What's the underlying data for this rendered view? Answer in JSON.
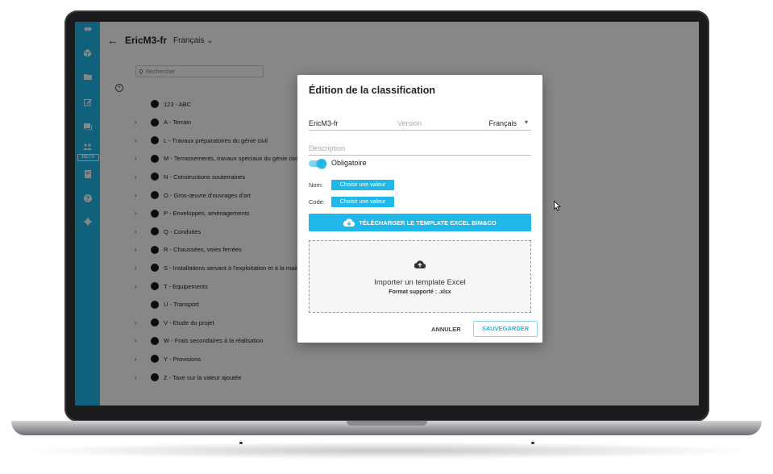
{
  "header": {
    "back_label": "←",
    "project_name": "EricM3-fr",
    "language": "Français",
    "language_chevron": "⌄"
  },
  "search": {
    "placeholder": "Rechercher"
  },
  "sidebar": {
    "icons": [
      "handshake-icon",
      "cube-icon",
      "folder-icon",
      "edit-icon",
      "chat-icon",
      "users-icon",
      "document-icon",
      "help-icon",
      "settings-icon"
    ],
    "beta_label": "BETA"
  },
  "tree": {
    "add_label": "+",
    "items": [
      {
        "label": "123 - ABC",
        "expandable": false
      },
      {
        "label": "A - Terrain",
        "expandable": true
      },
      {
        "label": "L - Travaux préparatoires du génie civil",
        "expandable": true
      },
      {
        "label": "M - Terrassements, travaux spéciaux du génie civil",
        "expandable": true
      },
      {
        "label": "N - Constructions souterraines",
        "expandable": true
      },
      {
        "label": "O - Gros-œuvre d'ouvrages d'art",
        "expandable": true
      },
      {
        "label": "P - Enveloppes, aménagements",
        "expandable": true
      },
      {
        "label": "Q - Conduites",
        "expandable": true
      },
      {
        "label": "R - Chaussées, voies ferrées",
        "expandable": true
      },
      {
        "label": "S - Installations servant à l'exploitation et à la maintenance",
        "expandable": true
      },
      {
        "label": "T - Equipements",
        "expandable": true
      },
      {
        "label": "U - Transport",
        "expandable": false
      },
      {
        "label": "V - Etude du projet",
        "expandable": true
      },
      {
        "label": "W - Frais secondaires à la réalisation",
        "expandable": true
      },
      {
        "label": "Y - Provisions",
        "expandable": true
      },
      {
        "label": "Z - Taxe sur la valeur ajoutée",
        "expandable": true
      }
    ]
  },
  "dialog": {
    "title": "Édition de la classification",
    "name_value": "EricM3-fr",
    "version_placeholder": "Version",
    "language_value": "Français",
    "language_chevron": "▾",
    "description_placeholder": "Description",
    "mandatory_label": "Obligatoire",
    "mandatory_on": true,
    "name_label": "Nom:",
    "code_label": "Code:",
    "choose_value_label": "Choisir une valeur",
    "download_template_label": "TÉLÉCHARGER LE TEMPLATE EXCEL BIM&CO",
    "import_title": "Importer un template Excel",
    "import_format": "Format supporté : .xlsx",
    "cancel_label": "ANNULER",
    "save_label": "SAUVEGARDER"
  },
  "colors": {
    "accent": "#1fb8e8",
    "overlay": "rgba(0,0,0,0.47)"
  }
}
